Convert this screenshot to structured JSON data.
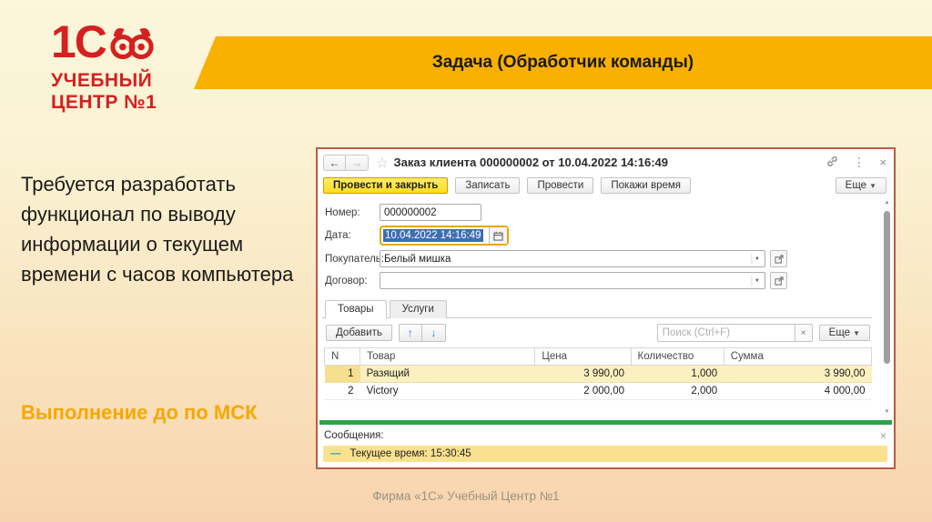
{
  "slide": {
    "logo": {
      "mark": "1С",
      "line1": "УЧЕБНЫЙ",
      "line2": "ЦЕНТР №1"
    },
    "banner_title": "Задача (Обработчик команды)",
    "task_text": "Требуется разработать функционал по выводу информации о текущем времени с часов компьютера",
    "deadline_text": "Выполнение до по МСК",
    "footer": "Фирма «1С» Учебный Центр №1"
  },
  "window": {
    "title": "Заказ клиента 000000002 от 10.04.2022 14:16:49",
    "toolbar": {
      "post_close": "Провести и закрыть",
      "save": "Записать",
      "post": "Провести",
      "show_time": "Покажи время",
      "more": "Еще"
    },
    "fields": {
      "number_label": "Номер:",
      "number_value": "000000002",
      "date_label": "Дата:",
      "date_value": "10.04.2022 14:16:49",
      "customer_label": "Покупатель:",
      "customer_value": "Белый мишка",
      "contract_label": "Договор:",
      "contract_value": ""
    },
    "tabs": [
      {
        "label": "Товары",
        "active": true
      },
      {
        "label": "Услуги",
        "active": false
      }
    ],
    "table_toolbar": {
      "add": "Добавить",
      "search_placeholder": "Поиск (Ctrl+F)",
      "more": "Еще"
    },
    "table": {
      "columns": [
        "N",
        "Товар",
        "Цена",
        "Количество",
        "Сумма"
      ],
      "rows": [
        {
          "n": "1",
          "product": "Разящий",
          "price": "3 990,00",
          "qty": "1,000",
          "sum": "3 990,00"
        },
        {
          "n": "2",
          "product": "Victory",
          "price": "2 000,00",
          "qty": "2,000",
          "sum": "4 000,00"
        }
      ]
    },
    "messages": {
      "header": "Сообщения:",
      "items": [
        "Текущее время: 15:30:45"
      ]
    }
  },
  "icons": {
    "back": "←",
    "forward": "→",
    "star": "☆",
    "kebab": "⋮",
    "close": "×",
    "dropdown": "▼",
    "combo_dropdown": "▼",
    "up": "↑",
    "down": "↓",
    "clear": "×",
    "dash": "—",
    "scroll_up": "▲",
    "scroll_down": "▼"
  },
  "colors": {
    "brand_red": "#D6201F",
    "banner_orange": "#F9B000",
    "deadline_orange": "#F6A800",
    "primary_button_yellow": "#FFDD1E",
    "selection_blue": "#3F6DB5",
    "selected_row_yellow": "#FCF0C1",
    "message_bar_yellow": "#FAE18F",
    "splitter_green": "#2AA347",
    "window_border": "#B95C45"
  }
}
